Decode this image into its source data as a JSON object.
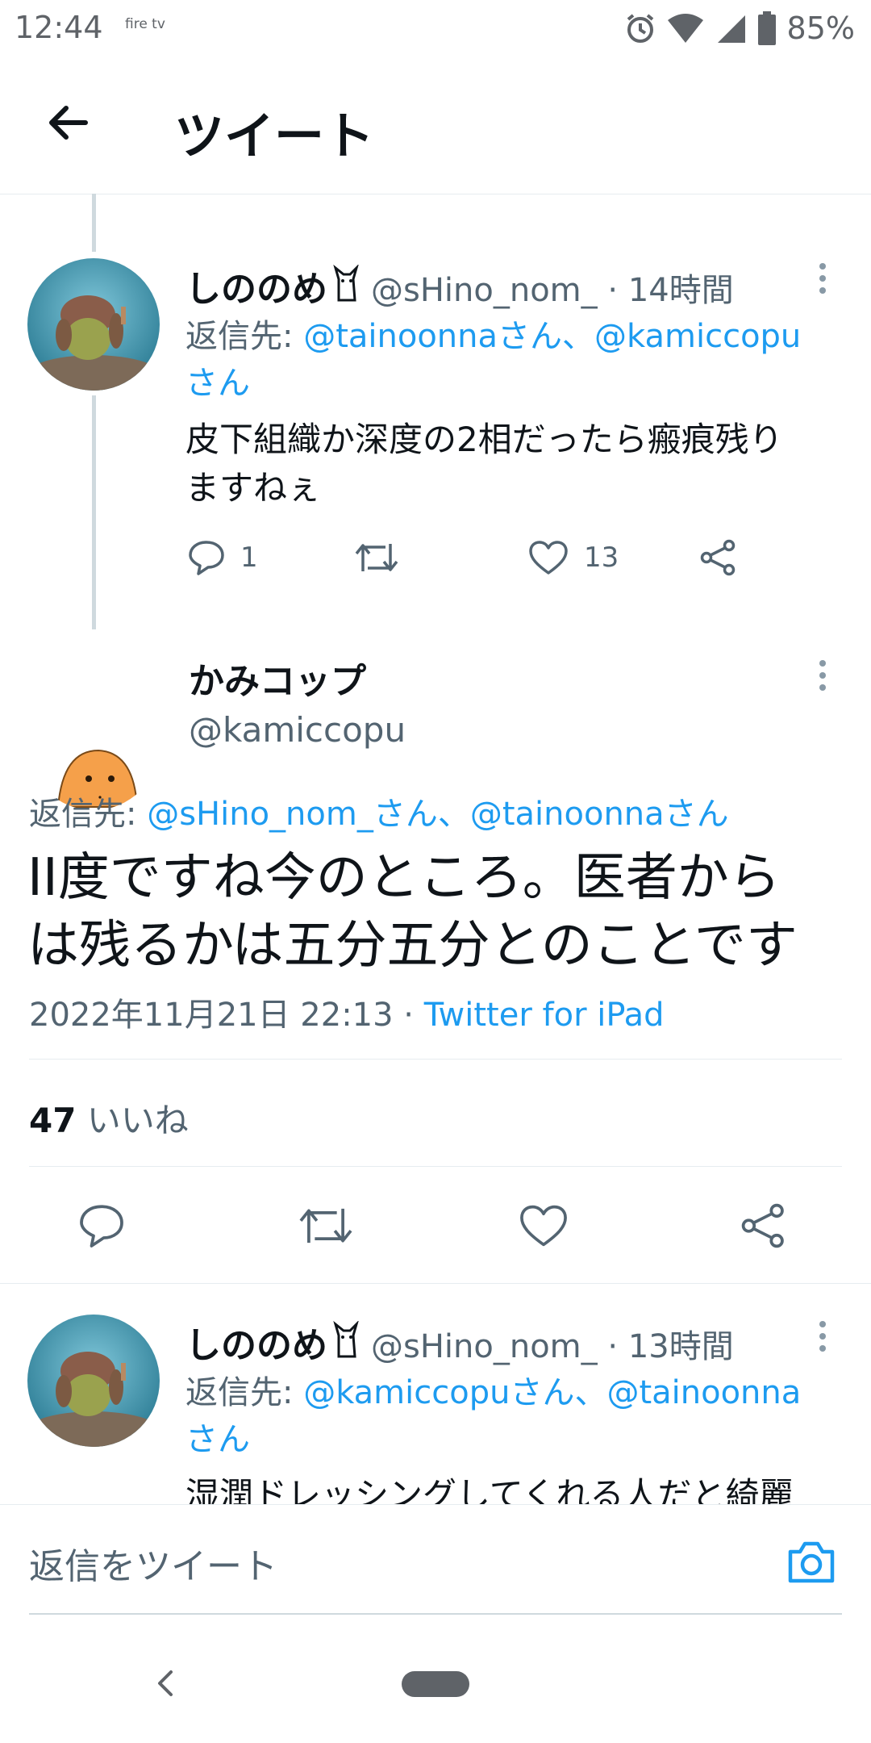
{
  "status_bar": {
    "time": "12:44",
    "firetv": "fire tv",
    "battery": "85%"
  },
  "app_bar": {
    "title": "ツイート"
  },
  "tweet_1": {
    "name": "しののめ",
    "handle": "@sHino_nom_",
    "time": "14時間",
    "reply_prefix": "返信先: ",
    "reply_to_1": "@tainoonnaさん、",
    "reply_to_2": "@kamiccopu",
    "reply_to_3": "さん",
    "text_line1": "皮下組織か深度の2相だったら瘢痕残り",
    "text_line2": "ますねぇ",
    "reply_count": "1",
    "like_count": "13"
  },
  "main_tweet": {
    "name": "かみコップ",
    "handle": "@kamiccopu",
    "reply_prefix": "返信先: ",
    "reply_to": "@sHino_nom_さん、@tainoonnaさん",
    "text_line1": "II度ですね今のところ。医者から",
    "text_line2": "は残るかは五分五分とのことです",
    "datetime": "2022年11月21日 22:13 · ",
    "source": "Twitter for iPad",
    "likes_count": "47",
    "likes_label": " いいね"
  },
  "tweet_3": {
    "name": "しののめ",
    "handle": "@sHino_nom_",
    "time": "13時間",
    "reply_prefix": "返信先: ",
    "reply_to_1": "@kamiccopuさん、",
    "reply_to_2": "@tainoonna",
    "reply_to_3": "さん",
    "text_line1": "湿潤ドレッシングしてくれる人だと綺麗"
  },
  "reply_bar": {
    "placeholder": "返信をツイート"
  },
  "colors": {
    "accent": "#1d9bf0",
    "secondary": "#536471"
  }
}
